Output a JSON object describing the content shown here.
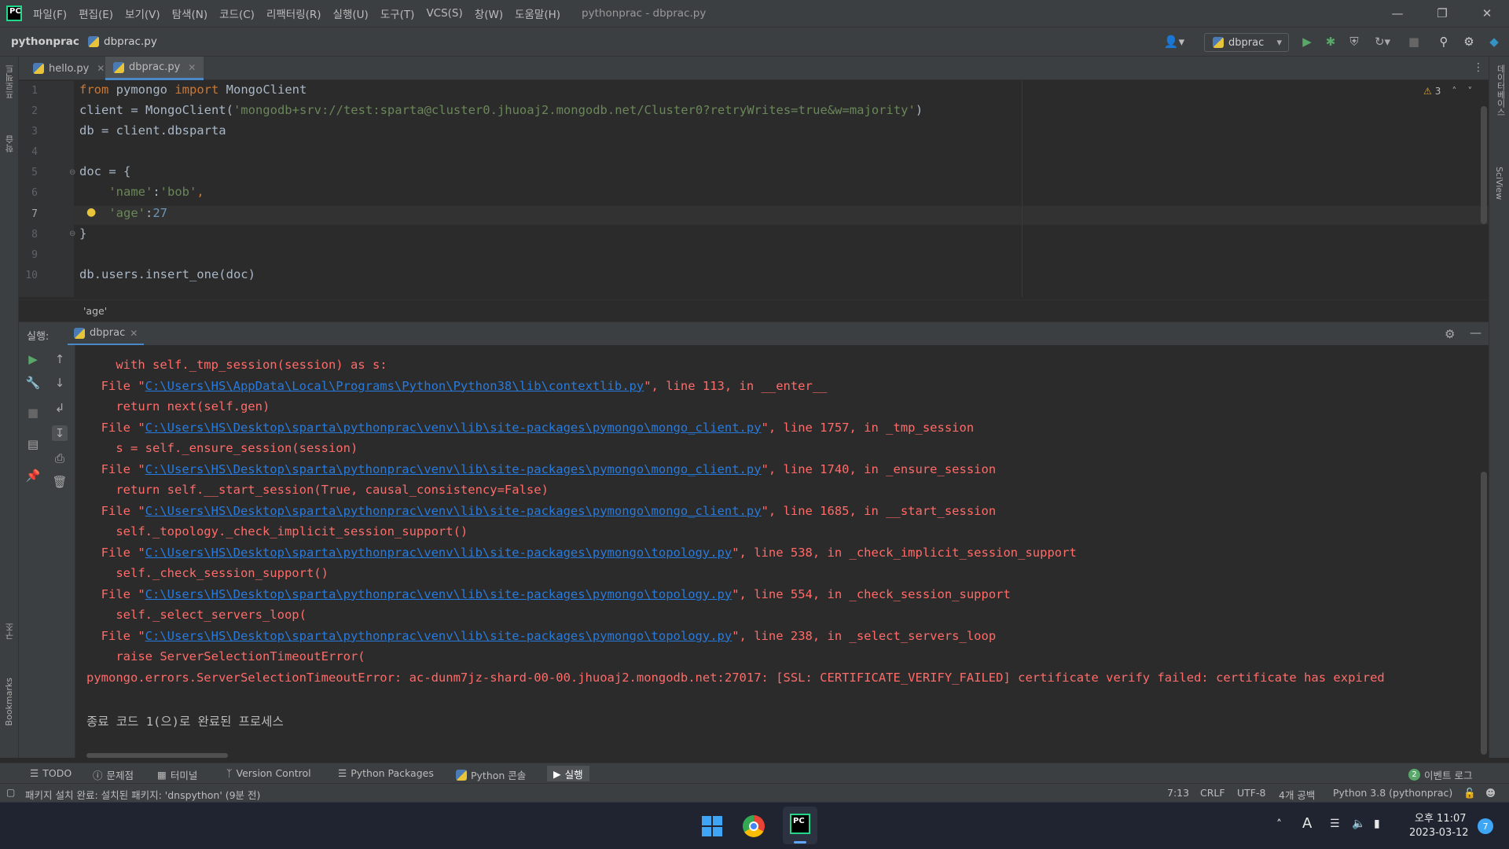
{
  "app": {
    "menu": [
      "파일(F)",
      "편집(E)",
      "보기(V)",
      "탐색(N)",
      "코드(C)",
      "리팩터링(R)",
      "실행(U)",
      "도구(T)",
      "VCS(S)",
      "창(W)",
      "도움말(H)"
    ],
    "window_title": "pythonprac - dbprac.py"
  },
  "nav": {
    "project": "pythonprac",
    "file": "dbprac.py",
    "run_config": "dbprac"
  },
  "left_strip": {
    "project_label": "프로젝트",
    "learn_label": "학습",
    "structure_label": "구조",
    "bookmarks_label": "Bookmarks"
  },
  "right_strip": {
    "database_label": "데이터베이스",
    "sciview_label": "SciView"
  },
  "tabs": [
    {
      "label": "hello.py"
    },
    {
      "label": "dbprac.py"
    }
  ],
  "editor": {
    "warning_count": "3",
    "line_numbers": [
      "1",
      "2",
      "3",
      "4",
      "5",
      "6",
      "7",
      "8",
      "9",
      "10"
    ],
    "lines": {
      "l1_from": "from",
      "l1_mod": " pymongo ",
      "l1_import": "import",
      "l1_name": " MongoClient",
      "l2_a": "client = MongoClient(",
      "l2_str": "'mongodb+srv://test:sparta@cluster0.jhuoaj2.mongodb.net/Cluster0?retryWrites=true&w=majority'",
      "l2_b": ")",
      "l3": "db = client.dbsparta",
      "l5": "doc = {",
      "l6_key": "    'name'",
      "l6_sep": ":",
      "l6_val": "'bob'",
      "l6_end": ",",
      "l7_key": "    'age'",
      "l7_sep": ":",
      "l7_val": "27",
      "l8": "}",
      "l10": "db.users.insert_one(doc)"
    },
    "breadcrumb": "'age'"
  },
  "run": {
    "label": "실행:",
    "tab": "dbprac",
    "console": [
      {
        "indent": "    ",
        "text": "with self._tmp_session(session) as s:"
      },
      {
        "pre": "  File \"",
        "link": "C:\\Users\\HS\\AppData\\Local\\Programs\\Python\\Python38\\lib\\contextlib.py",
        "post": "\", line 113, in __enter__"
      },
      {
        "indent": "    ",
        "text": "return next(self.gen)"
      },
      {
        "pre": "  File \"",
        "link": "C:\\Users\\HS\\Desktop\\sparta\\pythonprac\\venv\\lib\\site-packages\\pymongo\\mongo_client.py",
        "post": "\", line 1757, in _tmp_session"
      },
      {
        "indent": "    ",
        "text": "s = self._ensure_session(session)"
      },
      {
        "pre": "  File \"",
        "link": "C:\\Users\\HS\\Desktop\\sparta\\pythonprac\\venv\\lib\\site-packages\\pymongo\\mongo_client.py",
        "post": "\", line 1740, in _ensure_session"
      },
      {
        "indent": "    ",
        "text": "return self.__start_session(True, causal_consistency=False)"
      },
      {
        "pre": "  File \"",
        "link": "C:\\Users\\HS\\Desktop\\sparta\\pythonprac\\venv\\lib\\site-packages\\pymongo\\mongo_client.py",
        "post": "\", line 1685, in __start_session"
      },
      {
        "indent": "    ",
        "text": "self._topology._check_implicit_session_support()"
      },
      {
        "pre": "  File \"",
        "link": "C:\\Users\\HS\\Desktop\\sparta\\pythonprac\\venv\\lib\\site-packages\\pymongo\\topology.py",
        "post": "\", line 538, in _check_implicit_session_support"
      },
      {
        "indent": "    ",
        "text": "self._check_session_support()"
      },
      {
        "pre": "  File \"",
        "link": "C:\\Users\\HS\\Desktop\\sparta\\pythonprac\\venv\\lib\\site-packages\\pymongo\\topology.py",
        "post": "\", line 554, in _check_session_support"
      },
      {
        "indent": "    ",
        "text": "self._select_servers_loop("
      },
      {
        "pre": "  File \"",
        "link": "C:\\Users\\HS\\Desktop\\sparta\\pythonprac\\venv\\lib\\site-packages\\pymongo\\topology.py",
        "post": "\", line 238, in _select_servers_loop"
      },
      {
        "indent": "    ",
        "text": "raise ServerSelectionTimeoutError("
      }
    ],
    "error_line": "pymongo.errors.ServerSelectionTimeoutError: ac-dunm7jz-shard-00-00.jhuoaj2.mongodb.net:27017: [SSL: CERTIFICATE_VERIFY_FAILED] certificate verify failed: certificate has expired",
    "exit_line": "종료 코드 1(으)로 완료된 프로세스"
  },
  "bottom_tabs": [
    {
      "label": "TODO"
    },
    {
      "label": "문제점"
    },
    {
      "label": "터미널"
    },
    {
      "label": "Version Control"
    },
    {
      "label": "Python Packages"
    },
    {
      "label": "Python 콘솔"
    },
    {
      "label": "실행"
    }
  ],
  "event_log": {
    "count": "2",
    "label": "이벤트 로그"
  },
  "status": {
    "message": "패키지 설치 완료: 설치된 패키지: 'dnspython' (9분 전)",
    "position": "7:13",
    "line_sep": "CRLF",
    "encoding": "UTF-8",
    "indent": "4개 공백",
    "interpreter": "Python 3.8 (pythonprac)"
  },
  "taskbar": {
    "ime": "A",
    "time": "오후 11:07",
    "date": "2023-03-12",
    "notification_count": "7"
  },
  "colors": {
    "keyword": "#cc7832",
    "string": "#6a8759",
    "number": "#6897bb",
    "error": "#ff6b68",
    "link": "#287bde"
  }
}
